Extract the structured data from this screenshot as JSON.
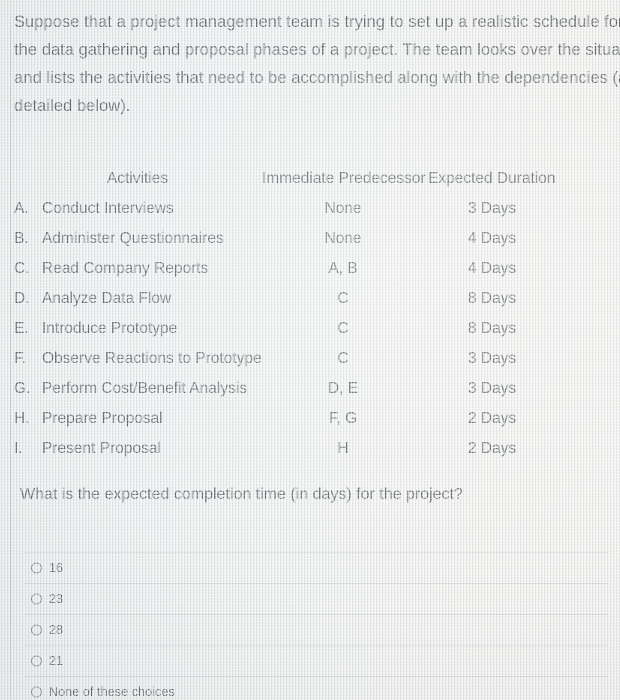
{
  "prompt": {
    "lines": [
      "Suppose that a project management team is trying to set up a realistic schedule for",
      "the data gathering and proposal phases of a project. The team looks over the situation",
      "and lists the activities that need to be accomplished along with the dependencies (as",
      "detailed below)."
    ]
  },
  "table": {
    "headers": {
      "activities": "Activities",
      "predecessor": "Immediate Predecessor",
      "duration": "Expected Duration"
    },
    "rows": [
      {
        "letter": "A.",
        "name": "Conduct Interviews",
        "predecessor": "None",
        "duration": "3 Days"
      },
      {
        "letter": "B.",
        "name": "Administer Questionnaires",
        "predecessor": "None",
        "duration": "4 Days"
      },
      {
        "letter": "C.",
        "name": "Read Company Reports",
        "predecessor": "A, B",
        "duration": "4 Days"
      },
      {
        "letter": "D.",
        "name": "Analyze Data Flow",
        "predecessor": "C",
        "duration": "8 Days"
      },
      {
        "letter": "E.",
        "name": "Introduce Prototype",
        "predecessor": "C",
        "duration": "8 Days"
      },
      {
        "letter": "F.",
        "name": "Observe Reactions to Prototype",
        "predecessor": "C",
        "duration": "3 Days"
      },
      {
        "letter": "G.",
        "name": "Perform Cost/Benefit Analysis",
        "predecessor": "D, E",
        "duration": "3 Days"
      },
      {
        "letter": "H.",
        "name": "Prepare Proposal",
        "predecessor": "F, G",
        "duration": "2 Days"
      },
      {
        "letter": "I.",
        "name": "Present Proposal",
        "predecessor": "H",
        "duration": "2 Days"
      }
    ]
  },
  "question": {
    "text": "What is the expected completion time (in days) for the project?"
  },
  "options": [
    {
      "label": "16",
      "selected": false
    },
    {
      "label": "23",
      "selected": false
    },
    {
      "label": "28",
      "selected": false
    },
    {
      "label": "21",
      "selected": false
    },
    {
      "label": "None of these choices",
      "selected": false
    }
  ],
  "colors": {
    "text": "#3a3f44",
    "background_left": "#e6eaea",
    "background_right": "#f1f0ed",
    "divider": "#96a2a8",
    "radio_outline": "#6d767c"
  }
}
